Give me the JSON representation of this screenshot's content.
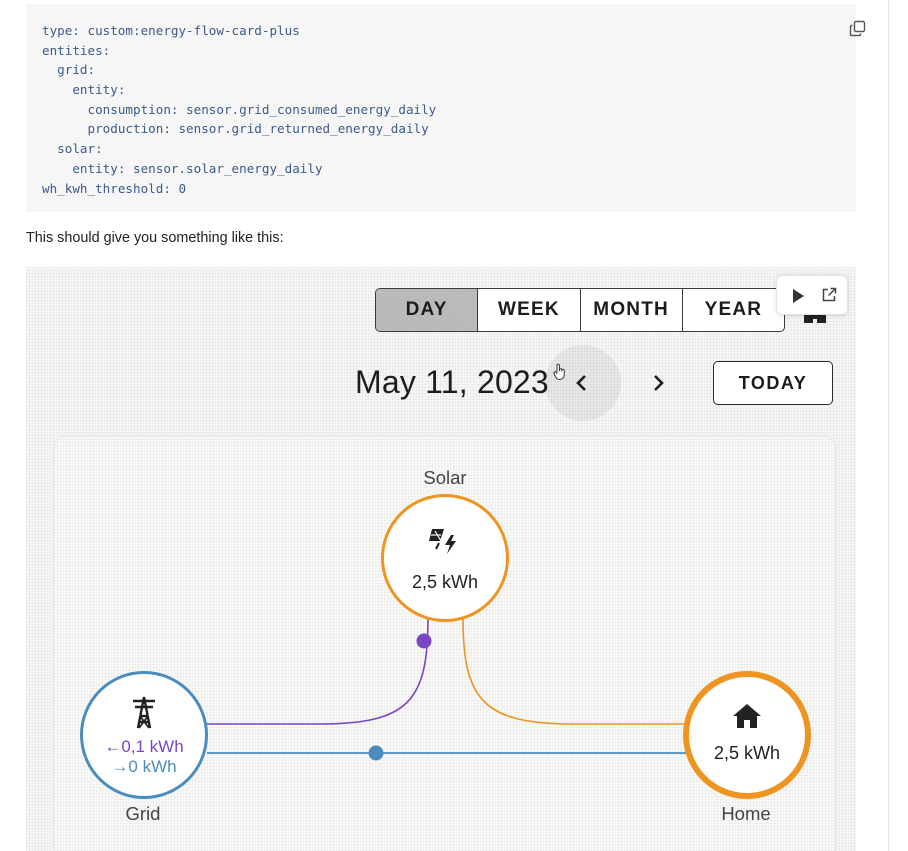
{
  "code": {
    "lines": [
      "type: custom:energy-flow-card-plus",
      "entities:",
      "  grid:",
      "    entity:",
      "      consumption: sensor.grid_consumed_energy_daily",
      "      production: sensor.grid_returned_energy_daily",
      "  solar:",
      "    entity: sensor.solar_energy_daily",
      "wh_kwh_threshold: 0"
    ],
    "copy_icon": "copy-icon"
  },
  "paragraph": "This should give you something like this:",
  "screenshot": {
    "periods": [
      {
        "label": "DAY",
        "active": true
      },
      {
        "label": "WEEK",
        "active": false
      },
      {
        "label": "MONTH",
        "active": false
      },
      {
        "label": "YEAR",
        "active": false
      }
    ],
    "date": "May 11, 2023",
    "today_label": "TODAY",
    "nodes": {
      "solar": {
        "title": "Solar",
        "value": "2,5 kWh",
        "icon": "solar-power-icon",
        "color": "#ef9421"
      },
      "grid": {
        "title": "Grid",
        "consumption": "←0,1 kWh",
        "return": "→0 kWh",
        "icon": "transmission-tower-icon",
        "color": "#4b8cbf",
        "consumption_color": "#7b45c3"
      },
      "home": {
        "title": "Home",
        "value": "2,5 kWh",
        "icon": "home-icon",
        "color": "#ef9421"
      }
    },
    "flow_colors": {
      "solar_to_home": "#ef9421",
      "grid_to_home": "#4b8cbf",
      "solar_to_grid": "#7b45c3"
    }
  }
}
